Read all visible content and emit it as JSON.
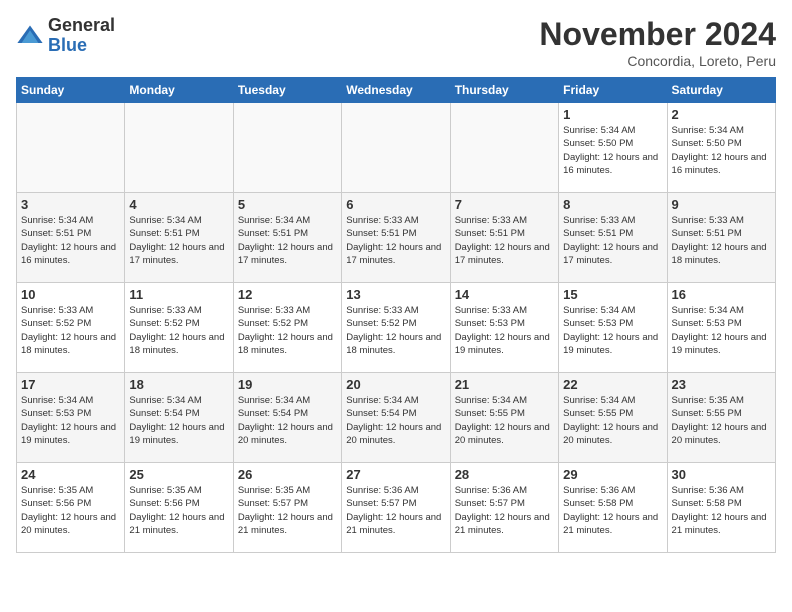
{
  "header": {
    "logo_general": "General",
    "logo_blue": "Blue",
    "title": "November 2024",
    "subtitle": "Concordia, Loreto, Peru"
  },
  "days_of_week": [
    "Sunday",
    "Monday",
    "Tuesday",
    "Wednesday",
    "Thursday",
    "Friday",
    "Saturday"
  ],
  "weeks": [
    [
      {
        "day": "",
        "info": ""
      },
      {
        "day": "",
        "info": ""
      },
      {
        "day": "",
        "info": ""
      },
      {
        "day": "",
        "info": ""
      },
      {
        "day": "",
        "info": ""
      },
      {
        "day": "1",
        "info": "Sunrise: 5:34 AM\nSunset: 5:50 PM\nDaylight: 12 hours\nand 16 minutes."
      },
      {
        "day": "2",
        "info": "Sunrise: 5:34 AM\nSunset: 5:50 PM\nDaylight: 12 hours\nand 16 minutes."
      }
    ],
    [
      {
        "day": "3",
        "info": "Sunrise: 5:34 AM\nSunset: 5:51 PM\nDaylight: 12 hours\nand 16 minutes."
      },
      {
        "day": "4",
        "info": "Sunrise: 5:34 AM\nSunset: 5:51 PM\nDaylight: 12 hours\nand 17 minutes."
      },
      {
        "day": "5",
        "info": "Sunrise: 5:34 AM\nSunset: 5:51 PM\nDaylight: 12 hours\nand 17 minutes."
      },
      {
        "day": "6",
        "info": "Sunrise: 5:33 AM\nSunset: 5:51 PM\nDaylight: 12 hours\nand 17 minutes."
      },
      {
        "day": "7",
        "info": "Sunrise: 5:33 AM\nSunset: 5:51 PM\nDaylight: 12 hours\nand 17 minutes."
      },
      {
        "day": "8",
        "info": "Sunrise: 5:33 AM\nSunset: 5:51 PM\nDaylight: 12 hours\nand 17 minutes."
      },
      {
        "day": "9",
        "info": "Sunrise: 5:33 AM\nSunset: 5:51 PM\nDaylight: 12 hours\nand 18 minutes."
      }
    ],
    [
      {
        "day": "10",
        "info": "Sunrise: 5:33 AM\nSunset: 5:52 PM\nDaylight: 12 hours\nand 18 minutes."
      },
      {
        "day": "11",
        "info": "Sunrise: 5:33 AM\nSunset: 5:52 PM\nDaylight: 12 hours\nand 18 minutes."
      },
      {
        "day": "12",
        "info": "Sunrise: 5:33 AM\nSunset: 5:52 PM\nDaylight: 12 hours\nand 18 minutes."
      },
      {
        "day": "13",
        "info": "Sunrise: 5:33 AM\nSunset: 5:52 PM\nDaylight: 12 hours\nand 18 minutes."
      },
      {
        "day": "14",
        "info": "Sunrise: 5:33 AM\nSunset: 5:53 PM\nDaylight: 12 hours\nand 19 minutes."
      },
      {
        "day": "15",
        "info": "Sunrise: 5:34 AM\nSunset: 5:53 PM\nDaylight: 12 hours\nand 19 minutes."
      },
      {
        "day": "16",
        "info": "Sunrise: 5:34 AM\nSunset: 5:53 PM\nDaylight: 12 hours\nand 19 minutes."
      }
    ],
    [
      {
        "day": "17",
        "info": "Sunrise: 5:34 AM\nSunset: 5:53 PM\nDaylight: 12 hours\nand 19 minutes."
      },
      {
        "day": "18",
        "info": "Sunrise: 5:34 AM\nSunset: 5:54 PM\nDaylight: 12 hours\nand 19 minutes."
      },
      {
        "day": "19",
        "info": "Sunrise: 5:34 AM\nSunset: 5:54 PM\nDaylight: 12 hours\nand 20 minutes."
      },
      {
        "day": "20",
        "info": "Sunrise: 5:34 AM\nSunset: 5:54 PM\nDaylight: 12 hours\nand 20 minutes."
      },
      {
        "day": "21",
        "info": "Sunrise: 5:34 AM\nSunset: 5:55 PM\nDaylight: 12 hours\nand 20 minutes."
      },
      {
        "day": "22",
        "info": "Sunrise: 5:34 AM\nSunset: 5:55 PM\nDaylight: 12 hours\nand 20 minutes."
      },
      {
        "day": "23",
        "info": "Sunrise: 5:35 AM\nSunset: 5:55 PM\nDaylight: 12 hours\nand 20 minutes."
      }
    ],
    [
      {
        "day": "24",
        "info": "Sunrise: 5:35 AM\nSunset: 5:56 PM\nDaylight: 12 hours\nand 20 minutes."
      },
      {
        "day": "25",
        "info": "Sunrise: 5:35 AM\nSunset: 5:56 PM\nDaylight: 12 hours\nand 21 minutes."
      },
      {
        "day": "26",
        "info": "Sunrise: 5:35 AM\nSunset: 5:57 PM\nDaylight: 12 hours\nand 21 minutes."
      },
      {
        "day": "27",
        "info": "Sunrise: 5:36 AM\nSunset: 5:57 PM\nDaylight: 12 hours\nand 21 minutes."
      },
      {
        "day": "28",
        "info": "Sunrise: 5:36 AM\nSunset: 5:57 PM\nDaylight: 12 hours\nand 21 minutes."
      },
      {
        "day": "29",
        "info": "Sunrise: 5:36 AM\nSunset: 5:58 PM\nDaylight: 12 hours\nand 21 minutes."
      },
      {
        "day": "30",
        "info": "Sunrise: 5:36 AM\nSunset: 5:58 PM\nDaylight: 12 hours\nand 21 minutes."
      }
    ]
  ]
}
